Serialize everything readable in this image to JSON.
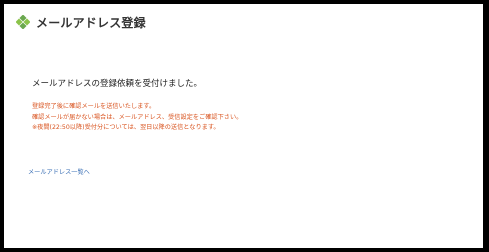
{
  "header": {
    "title": "メールアドレス登録",
    "icon": "green-diamond-icon",
    "icon_color": "#6aa84f"
  },
  "main": {
    "message": "メールアドレスの登録依頼を受付けました。",
    "notes": [
      "登録完了後に確認メールを送信いたします。",
      "確認メールが届かない場合は、メールアドレス、受信設定をご確認下さい。",
      "※夜間(22:50以降)受付分については、翌日以降の送信となります。"
    ],
    "note_color": "#d9531e"
  },
  "footer": {
    "back_link": "メールアドレス一覧へ",
    "link_color": "#3a6fb5"
  }
}
